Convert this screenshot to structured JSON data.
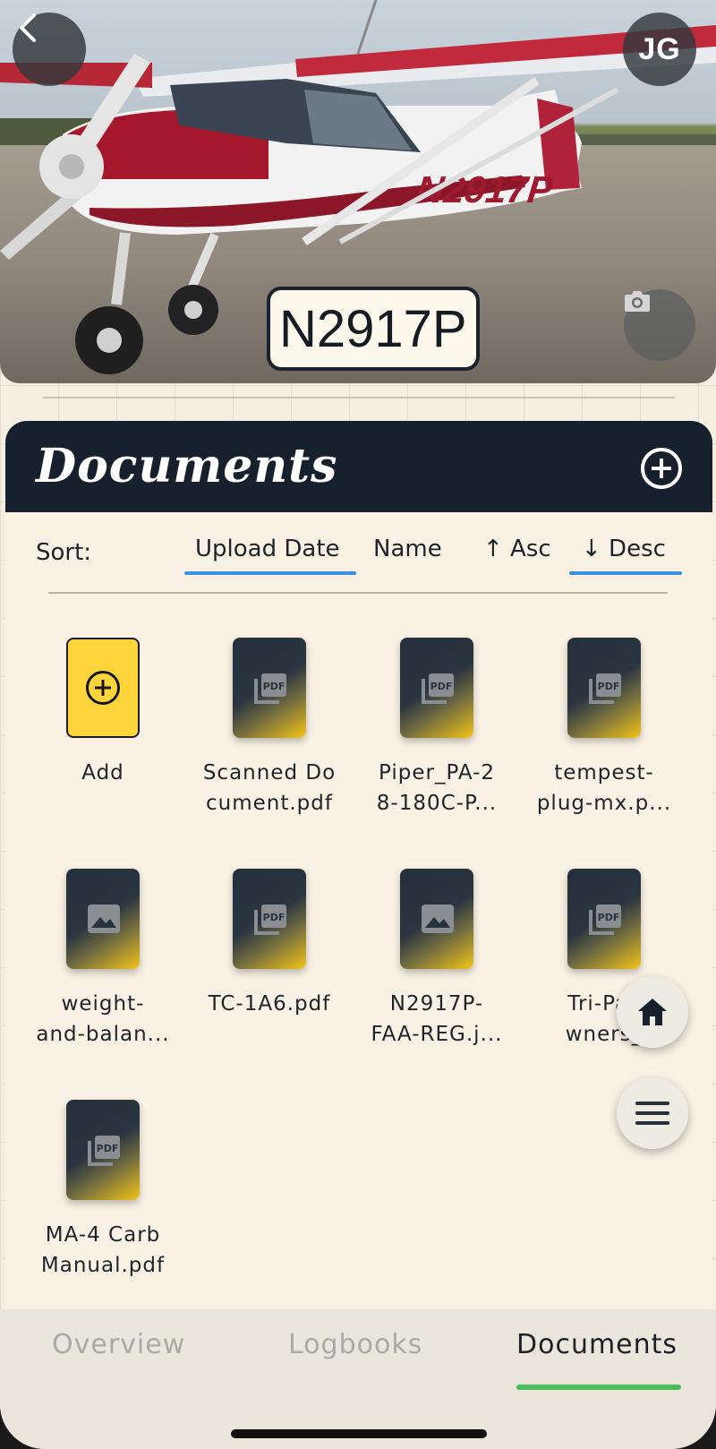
{
  "hero": {
    "tail_number": "N2917P",
    "avatar_initials": "JG",
    "back_icon": "chevron-left-icon",
    "camera_icon": "camera-icon"
  },
  "documents": {
    "title": "Documents",
    "add_icon": "plus-circle-icon",
    "sort": {
      "label": "Sort:",
      "options": [
        "Upload Date",
        "Name",
        "↑ Asc",
        "↓ Desc"
      ],
      "selected_field": "Upload Date",
      "selected_order": "↓ Desc"
    },
    "items": [
      {
        "label": "Add",
        "type": "add"
      },
      {
        "label": "Scanned Do\ncument.pdf",
        "type": "pdf"
      },
      {
        "label": "Piper_PA-2\n8-180C-P...",
        "type": "pdf"
      },
      {
        "label": "tempest-\nplug-mx.p...",
        "type": "pdf"
      },
      {
        "label": "weight-\nand-balan...",
        "type": "image"
      },
      {
        "label": "TC-1A6.pdf",
        "type": "pdf"
      },
      {
        "label": "N2917P-\nFAA-REG.j...",
        "type": "image"
      },
      {
        "label": "Tri-Pac\nwners_",
        "type": "pdf"
      },
      {
        "label": "MA-4 Carb\nManual.pdf",
        "type": "pdf"
      }
    ]
  },
  "fabs": {
    "home_icon": "home-icon",
    "menu_icon": "menu-icon"
  },
  "tabs": [
    {
      "label": "Overview",
      "active": false
    },
    {
      "label": "Logbooks",
      "active": false
    },
    {
      "label": "Documents",
      "active": true
    }
  ],
  "colors": {
    "header_navy": "#17212d",
    "accent_yellow": "#fdd43a",
    "sort_underline": "#3b8fe0",
    "tab_indicator": "#4cbb5a",
    "background": "#f8f1e4"
  }
}
